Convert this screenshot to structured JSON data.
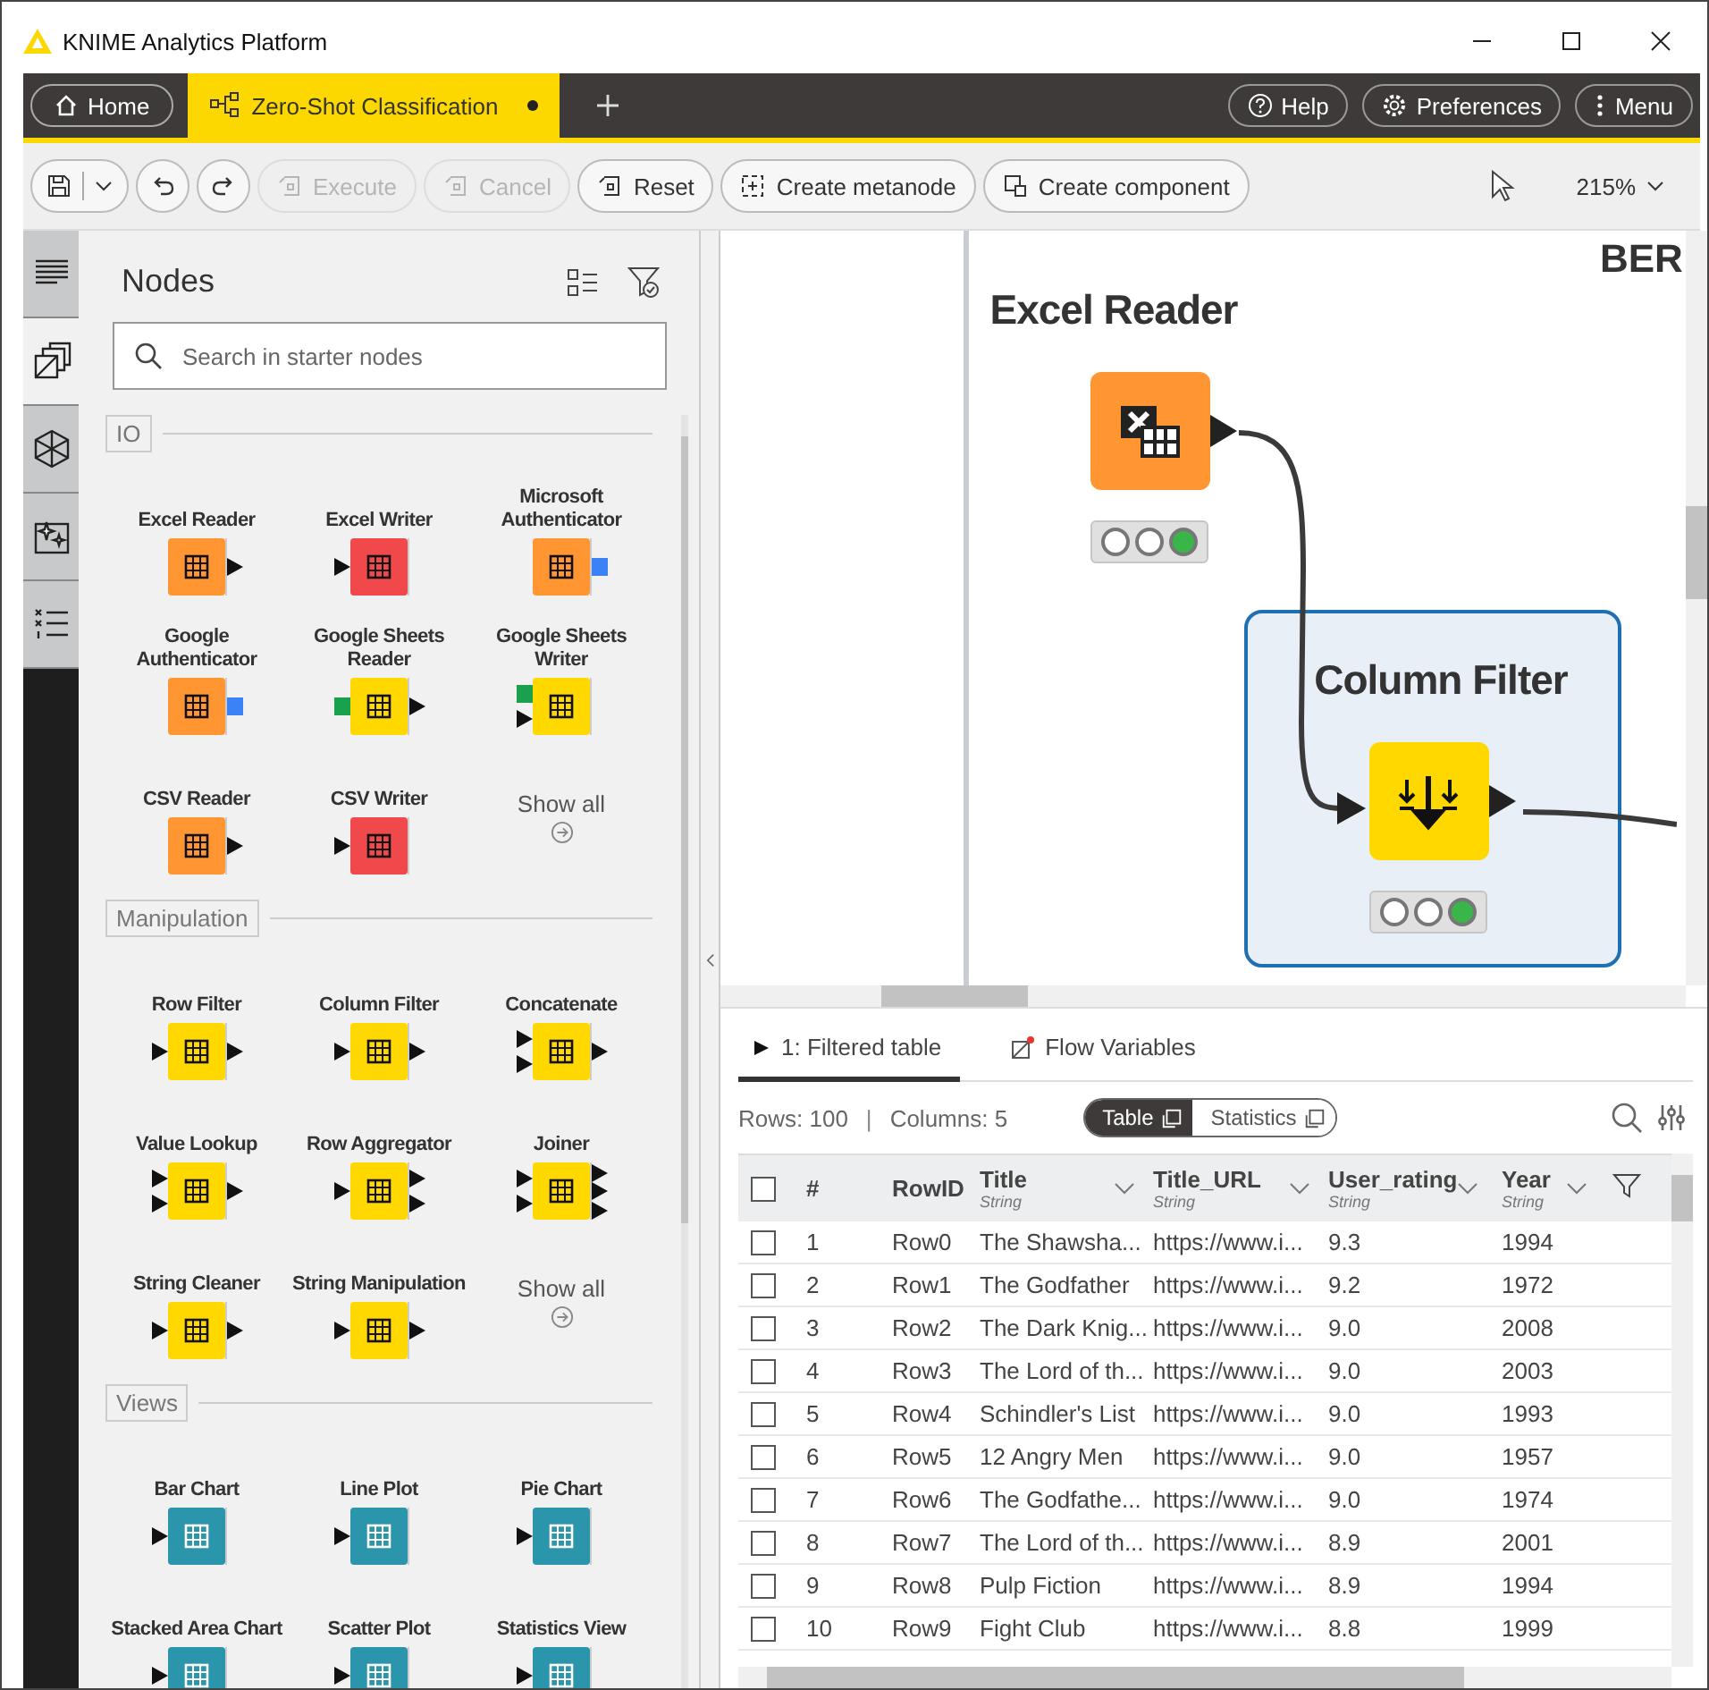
{
  "window": {
    "title": "KNIME Analytics Platform"
  },
  "app_tabs": [
    {
      "label": "Home",
      "kind": "home",
      "selected": false
    },
    {
      "label": "Zero-Shot Classification",
      "kind": "workflow",
      "selected": true,
      "unsaved": true
    }
  ],
  "header_buttons": [
    {
      "label": "Help",
      "kind": "help"
    },
    {
      "label": "Preferences",
      "kind": "preferences"
    },
    {
      "label": "Menu",
      "kind": "menu"
    }
  ],
  "toolbar": {
    "buttons": [
      {
        "label": "Execute",
        "kind": "execute",
        "disabled": true
      },
      {
        "label": "Cancel",
        "kind": "cancel",
        "disabled": true
      },
      {
        "label": "Reset",
        "kind": "reset",
        "disabled": false
      },
      {
        "label": "Create metanode",
        "kind": "metanode",
        "disabled": false
      },
      {
        "label": "Create component",
        "kind": "component",
        "disabled": false
      }
    ],
    "zoom": "215%"
  },
  "sidebar": {
    "items": [
      {
        "kind": "description",
        "selected": false
      },
      {
        "kind": "nodes",
        "selected": true
      },
      {
        "kind": "spaces",
        "selected": false
      },
      {
        "kind": "ai",
        "selected": false
      },
      {
        "kind": "monitor",
        "selected": false
      }
    ]
  },
  "nodes_panel": {
    "title": "Nodes",
    "search": {
      "placeholder": "Search in starter nodes"
    },
    "categories": [
      {
        "name": "IO",
        "show_all": "Show all",
        "nodes": [
          {
            "name": "Excel Reader",
            "kind": "source",
            "ports_out": [
              {
                "kind": "data"
              }
            ]
          },
          {
            "name": "Excel Writer",
            "kind": "sink",
            "ports_in": [
              {
                "kind": "data"
              }
            ]
          },
          {
            "name": "Microsoft Authenticator",
            "kind": "source",
            "ports_out": [
              {
                "kind": "credential"
              }
            ]
          },
          {
            "name": "Google Authenticator",
            "kind": "source",
            "ports_out": [
              {
                "kind": "credential"
              }
            ]
          },
          {
            "name": "Google Sheets Reader",
            "kind": "manipulator",
            "ports_in": [
              {
                "kind": "google"
              }
            ],
            "ports_out": [
              {
                "kind": "data"
              }
            ]
          },
          {
            "name": "Google Sheets Writer",
            "kind": "manipulator",
            "ports_in": [
              {
                "kind": "google"
              },
              {
                "kind": "data"
              }
            ]
          },
          {
            "name": "CSV Reader",
            "kind": "source",
            "ports_out": [
              {
                "kind": "data"
              }
            ]
          },
          {
            "name": "CSV Writer",
            "kind": "sink",
            "ports_in": [
              {
                "kind": "data"
              }
            ]
          }
        ]
      },
      {
        "name": "Manipulation",
        "show_all": "Show all",
        "nodes": [
          {
            "name": "Row Filter",
            "kind": "manipulator",
            "ports_in": [
              {
                "kind": "data"
              }
            ],
            "ports_out": [
              {
                "kind": "data"
              }
            ]
          },
          {
            "name": "Column Filter",
            "kind": "manipulator",
            "ports_in": [
              {
                "kind": "data"
              }
            ],
            "ports_out": [
              {
                "kind": "data"
              }
            ]
          },
          {
            "name": "Concatenate",
            "kind": "manipulator",
            "ports_in": [
              {
                "kind": "data"
              },
              {
                "kind": "data"
              }
            ],
            "ports_out": [
              {
                "kind": "data"
              }
            ]
          },
          {
            "name": "Value Lookup",
            "kind": "manipulator",
            "ports_in": [
              {
                "kind": "data"
              },
              {
                "kind": "data"
              }
            ],
            "ports_out": [
              {
                "kind": "data"
              }
            ]
          },
          {
            "name": "Row Aggregator",
            "kind": "manipulator",
            "ports_in": [
              {
                "kind": "data"
              }
            ],
            "ports_out": [
              {
                "kind": "data"
              },
              {
                "kind": "data"
              }
            ]
          },
          {
            "name": "Joiner",
            "kind": "manipulator",
            "ports_in": [
              {
                "kind": "data"
              },
              {
                "kind": "data"
              }
            ],
            "ports_out": [
              {
                "kind": "data"
              },
              {
                "kind": "data"
              },
              {
                "kind": "data"
              }
            ]
          },
          {
            "name": "String Cleaner",
            "kind": "manipulator",
            "ports_in": [
              {
                "kind": "data"
              }
            ],
            "ports_out": [
              {
                "kind": "data"
              }
            ]
          },
          {
            "name": "String Manipulation",
            "kind": "manipulator",
            "ports_in": [
              {
                "kind": "data"
              }
            ],
            "ports_out": [
              {
                "kind": "data"
              }
            ]
          }
        ]
      },
      {
        "name": "Views",
        "nodes": [
          {
            "name": "Bar Chart",
            "kind": "view",
            "ports_in": [
              {
                "kind": "data"
              }
            ]
          },
          {
            "name": "Line Plot",
            "kind": "view",
            "ports_in": [
              {
                "kind": "data"
              }
            ]
          },
          {
            "name": "Pie Chart",
            "kind": "view",
            "ports_in": [
              {
                "kind": "data"
              }
            ]
          },
          {
            "name": "Stacked Area Chart",
            "kind": "view",
            "ports_in": [
              {
                "kind": "data"
              }
            ]
          },
          {
            "name": "Scatter Plot",
            "kind": "view",
            "ports_in": [
              {
                "kind": "data"
              }
            ]
          },
          {
            "name": "Statistics View",
            "kind": "view",
            "ports_in": [
              {
                "kind": "data"
              }
            ]
          }
        ]
      }
    ]
  },
  "canvas": {
    "partial_label": "BER",
    "nodes": [
      {
        "name": "Excel Reader",
        "kind": "source",
        "lights": [
          {
            "on": false
          },
          {
            "on": false
          },
          {
            "on": true
          }
        ],
        "annotated": false
      },
      {
        "name": "Column Filter",
        "kind": "manipulator",
        "lights": [
          {
            "on": false
          },
          {
            "on": false
          },
          {
            "on": true
          }
        ],
        "annotated": true
      }
    ]
  },
  "output": {
    "tabs": [
      {
        "label": "1: Filtered table",
        "kind": "table",
        "selected": true
      },
      {
        "label": "Flow Variables",
        "kind": "variables",
        "selected": false
      }
    ],
    "rows_info": "Rows: 100",
    "separator": "|",
    "columns_info": "Columns: 5",
    "views": [
      {
        "label": "Table",
        "selected": true
      },
      {
        "label": "Statistics",
        "selected": false
      }
    ],
    "table": {
      "select_all": {
        "checked": false
      },
      "columns": [
        {
          "name": "#"
        },
        {
          "name": "RowID"
        },
        {
          "name": "Title",
          "type": "String"
        },
        {
          "name": "Title_URL",
          "type": "String"
        },
        {
          "name": "User_rating",
          "type": "String"
        },
        {
          "name": "Year",
          "type": "String"
        }
      ],
      "rows": [
        {
          "checked": false,
          "cells": [
            "1",
            "Row0",
            "The Shawsha...",
            "https://www.i...",
            "9.3",
            "1994"
          ]
        },
        {
          "checked": false,
          "cells": [
            "2",
            "Row1",
            "The Godfather",
            "https://www.i...",
            "9.2",
            "1972"
          ]
        },
        {
          "checked": false,
          "cells": [
            "3",
            "Row2",
            "The Dark Knig...",
            "https://www.i...",
            "9.0",
            "2008"
          ]
        },
        {
          "checked": false,
          "cells": [
            "4",
            "Row3",
            "The Lord of th...",
            "https://www.i...",
            "9.0",
            "2003"
          ]
        },
        {
          "checked": false,
          "cells": [
            "5",
            "Row4",
            "Schindler's List",
            "https://www.i...",
            "9.0",
            "1993"
          ]
        },
        {
          "checked": false,
          "cells": [
            "6",
            "Row5",
            "12 Angry Men",
            "https://www.i...",
            "9.0",
            "1957"
          ]
        },
        {
          "checked": false,
          "cells": [
            "7",
            "Row6",
            "The Godfathe...",
            "https://www.i...",
            "9.0",
            "1974"
          ]
        },
        {
          "checked": false,
          "cells": [
            "8",
            "Row7",
            "The Lord of th...",
            "https://www.i...",
            "8.9",
            "2001"
          ]
        },
        {
          "checked": false,
          "cells": [
            "9",
            "Row8",
            "Pulp Fiction",
            "https://www.i...",
            "8.9",
            "1994"
          ]
        },
        {
          "checked": false,
          "cells": [
            "10",
            "Row9",
            "Fight Club",
            "https://www.i...",
            "8.8",
            "1999"
          ]
        }
      ]
    }
  }
}
